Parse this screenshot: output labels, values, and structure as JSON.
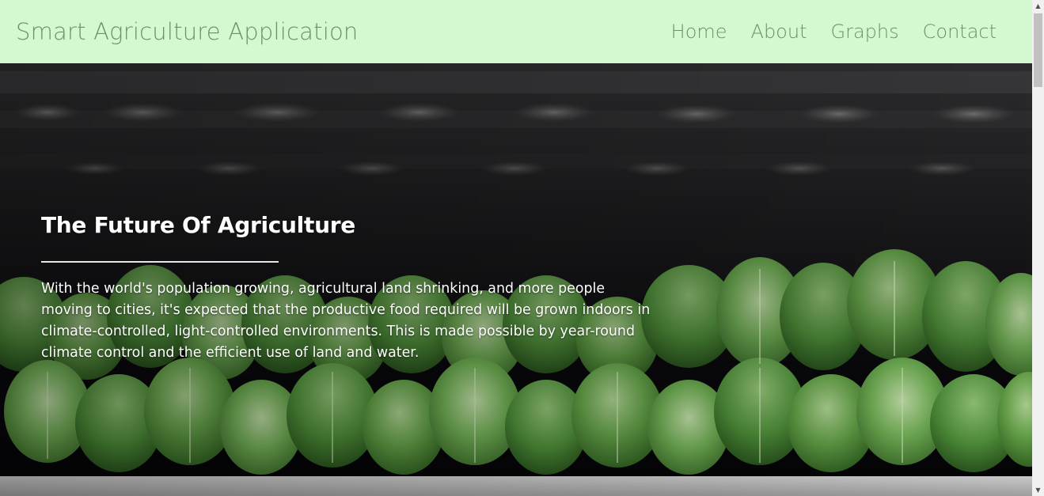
{
  "navbar": {
    "brand": "Smart Agriculture Application",
    "links": [
      {
        "label": "Home"
      },
      {
        "label": "About"
      },
      {
        "label": "Graphs"
      },
      {
        "label": "Contact"
      }
    ],
    "background_color": "#d4f8d0",
    "text_color": "#6f8f6b"
  },
  "hero": {
    "title": "The Future Of Agriculture",
    "paragraph": "With the world's population growing, agricultural land shrinking, and more people moving to cities, it's expected that the productive food required will be grown indoors in climate-controlled, light-controlled environments. This is made possible by year-round climate control and the efficient use of land and water.",
    "background_image": "indoor-lettuce-farm-photo"
  },
  "scrollbar": {
    "up_icon": "chevron-up-icon",
    "down_icon": "chevron-down-icon"
  }
}
